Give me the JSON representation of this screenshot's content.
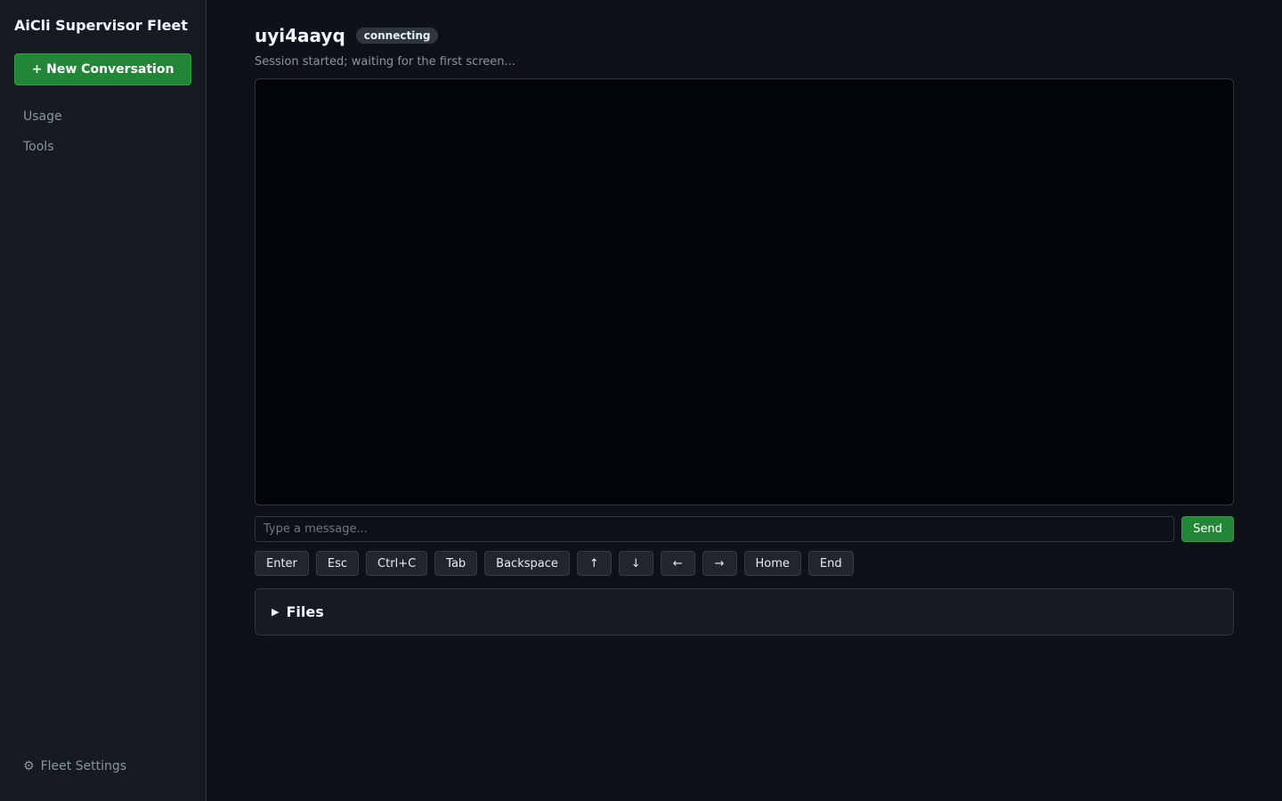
{
  "sidebar": {
    "brand": "AiCli Supervisor Fleet",
    "new_conversation_label": "+ New Conversation",
    "items": [
      {
        "label": "Usage"
      },
      {
        "label": "Tools"
      }
    ],
    "settings_icon": "⚙",
    "settings_label": "Fleet Settings"
  },
  "session": {
    "id": "uyi4aayq",
    "status": "connecting",
    "subtitle": "Session started; waiting for the first screen..."
  },
  "composer": {
    "placeholder": "Type a message...",
    "send_label": "Send"
  },
  "keys": [
    "Enter",
    "Esc",
    "Ctrl+C",
    "Tab",
    "Backspace",
    "↑",
    "↓",
    "←",
    "→",
    "Home",
    "End"
  ],
  "files": {
    "icon": "▶",
    "label": "Files"
  },
  "colors": {
    "accent": "#238636",
    "background": "#0e1117",
    "sidebar": "#161b22",
    "terminal": "#010409"
  }
}
